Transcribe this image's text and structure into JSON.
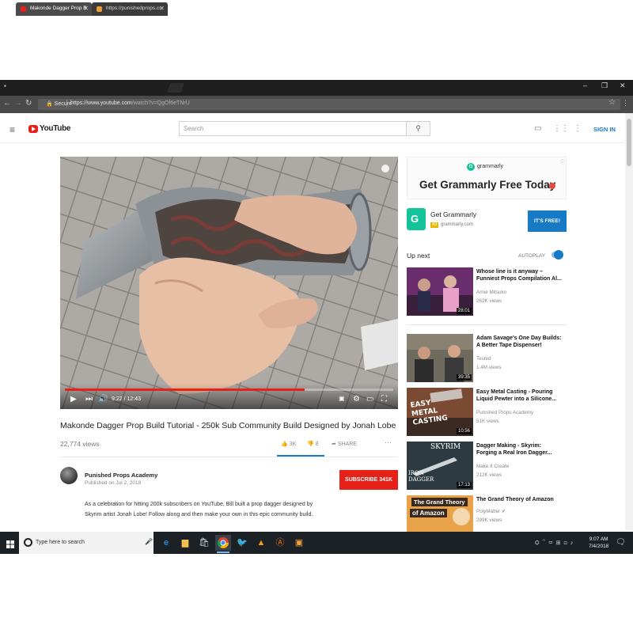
{
  "browser": {
    "tabs": [
      {
        "label": "Makonde Dagger Prop B",
        "active": true,
        "favicon_color": "#e62117"
      },
      {
        "label": "https://punishedprops.co",
        "active": false,
        "favicon_color": "#f0a030"
      }
    ],
    "tab_close": "✕",
    "window_controls": {
      "minimize": "–",
      "maximize": "❐",
      "close": "✕"
    },
    "secure_label": "Secure",
    "url_main": "https://www.youtube.com",
    "url_rest": "/watch?v=QgOf6eTNrU",
    "star": "☆",
    "menu": "⋮"
  },
  "youtube": {
    "logo_text": "YouTube",
    "search_placeholder": "Search",
    "sign_in": "SIGN IN"
  },
  "player": {
    "time": "9:22 / 12:43",
    "progress": 0.73
  },
  "video": {
    "title": "Makonde Dagger Prop Build Tutorial - 250k Sub Community Build Designed by Jonah Lobe",
    "views": "22,774 views",
    "likes": "3K",
    "dislikes": "8",
    "share": "SHARE",
    "more": "···"
  },
  "channel": {
    "name": "Punished Props Academy",
    "published": "Published on Jul 2, 2018",
    "subscribe_label": "SUBSCRIBE 341K",
    "description": "As a celebration for hitting 200k subscribers on YouTube, Bill built a prop dagger designed by Skyrim artist Jonah Lobe! Follow along and then make your own in this epic community build."
  },
  "ad": {
    "brand": "grammarly",
    "headline": "Get Grammarly Free Today",
    "promo_title": "Get Grammarly",
    "badge": "Ad",
    "promo_url": "grammarly.com",
    "cta": "IT'S FREE!"
  },
  "upnext": {
    "label": "Up next",
    "autoplay": "AUTOPLAY"
  },
  "related": [
    {
      "title": "Whose line is it anyway – Funniest Props Compilation Al...",
      "channel": "Arnie Mitsuko",
      "views": "262K views",
      "duration": "28:01"
    },
    {
      "title": "Adam Savage's One Day Builds: A Better Tape Dispenser!",
      "channel": "Tested",
      "views": "1.4M views",
      "duration": "39:35"
    },
    {
      "title": "Easy Metal Casting - Pouring Liquid Pewter into a Silicone...",
      "channel": "Punished Props Academy",
      "views": "51K views",
      "duration": "10:56",
      "overlay": "EASY METAL CASTING"
    },
    {
      "title": "Dagger Making - Skyrim: Forging a Real Iron Dagger...",
      "channel": "Make It Create",
      "views": "212K views",
      "duration": "17:13",
      "overlay_top": "SKYRIM",
      "overlay_bottom": "IRON DAGGER"
    },
    {
      "title": "The Grand Theory of Amazon",
      "channel": "PolyMatter",
      "views": "299K views",
      "overlay_top": "The Grand Theory",
      "overlay_bottom": "of Amazon"
    }
  ],
  "taskbar": {
    "search_placeholder": "Type here to search",
    "time": "9:07 AM",
    "date": "7/4/2018"
  }
}
